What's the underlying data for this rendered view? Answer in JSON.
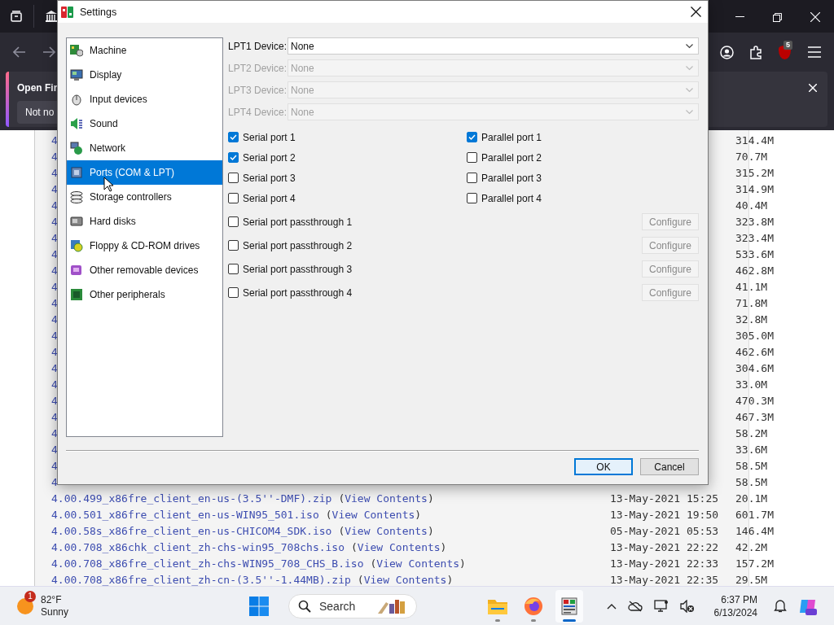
{
  "browser": {
    "notification": {
      "title": "Open Fir",
      "button": "Not no"
    },
    "extension_badge": "5"
  },
  "listing": {
    "rows": [
      {
        "name": "4",
        "size": "314.4M"
      },
      {
        "name": "4",
        "size": "70.7M"
      },
      {
        "name": "4",
        "size": "315.2M"
      },
      {
        "name": "4",
        "size": "314.9M"
      },
      {
        "name": "4",
        "size": "40.4M"
      },
      {
        "name": "4",
        "size": "323.8M"
      },
      {
        "name": "4",
        "size": "323.4M"
      },
      {
        "name": "4",
        "size": "533.6M"
      },
      {
        "name": "4",
        "size": "462.8M"
      },
      {
        "name": "4",
        "size": "41.1M"
      },
      {
        "name": "4",
        "size": "71.8M"
      },
      {
        "name": "4",
        "size": "32.8M"
      },
      {
        "name": "4",
        "size": "305.0M"
      },
      {
        "name": "4",
        "size": "462.6M"
      },
      {
        "name": "4",
        "size": "304.6M"
      },
      {
        "name": "4",
        "size": "33.0M"
      },
      {
        "name": "4",
        "size": "470.3M"
      },
      {
        "name": "4",
        "size": "467.3M"
      },
      {
        "name": "4",
        "size": "58.2M"
      },
      {
        "name": "4",
        "size": "33.6M"
      },
      {
        "name": "4",
        "size": "58.5M"
      },
      {
        "name": "4",
        "size": "58.5M"
      },
      {
        "name": "4.00.499_x86fre_client_en-us-(3.5''-DMF).zip",
        "link": "(View Contents)",
        "date": "13-May-2021 15:25",
        "size": "20.1M"
      },
      {
        "name": "4.00.501_x86fre_client_en-us-WIN95_501.iso",
        "link": "(View Contents)",
        "date": "13-May-2021 19:50",
        "size": "601.7M"
      },
      {
        "name": "4.00.58s_x86fre_client_en-us-CHICOM4_SDK.iso",
        "link": "(View Contents)",
        "date": "05-May-2021 05:53",
        "size": "146.4M"
      },
      {
        "name": "4.00.708_x86chk_client_zh-chs-win95_708chs.iso",
        "link": "(View Contents)",
        "date": "13-May-2021 22:22",
        "size": "42.2M"
      },
      {
        "name": "4.00.708_x86fre_client_zh-chs-WIN95_708_CHS_B.iso",
        "link": "(View Contents)",
        "date": "13-May-2021 22:33",
        "size": "157.2M"
      },
      {
        "name": "4.00.708_x86fre_client_zh-cn-(3.5''-1.44MB).zip",
        "link": "(View Contents)",
        "date": "13-May-2021 22:35",
        "size": "29.5M"
      }
    ]
  },
  "dialog": {
    "title": "Settings",
    "sidebar": {
      "items": [
        {
          "label": "Machine",
          "selected": false
        },
        {
          "label": "Display",
          "selected": false
        },
        {
          "label": "Input devices",
          "selected": false
        },
        {
          "label": "Sound",
          "selected": false
        },
        {
          "label": "Network",
          "selected": false
        },
        {
          "label": "Ports (COM & LPT)",
          "selected": true
        },
        {
          "label": "Storage controllers",
          "selected": false
        },
        {
          "label": "Hard disks",
          "selected": false
        },
        {
          "label": "Floppy & CD-ROM drives",
          "selected": false
        },
        {
          "label": "Other removable devices",
          "selected": false
        },
        {
          "label": "Other peripherals",
          "selected": false
        }
      ]
    },
    "lpt_devices": [
      {
        "label": "LPT1 Device:",
        "value": "None",
        "disabled": false
      },
      {
        "label": "LPT2 Device:",
        "value": "None",
        "disabled": true
      },
      {
        "label": "LPT3 Device:",
        "value": "None",
        "disabled": true
      },
      {
        "label": "LPT4 Device:",
        "value": "None",
        "disabled": true
      }
    ],
    "serial_ports": [
      {
        "label": "Serial port 1",
        "checked": true
      },
      {
        "label": "Serial port 2",
        "checked": true
      },
      {
        "label": "Serial port 3",
        "checked": false
      },
      {
        "label": "Serial port 4",
        "checked": false
      }
    ],
    "parallel_ports": [
      {
        "label": "Parallel port 1",
        "checked": true
      },
      {
        "label": "Parallel port 2",
        "checked": false
      },
      {
        "label": "Parallel port 3",
        "checked": false
      },
      {
        "label": "Parallel port 4",
        "checked": false
      }
    ],
    "passthrough": [
      {
        "label": "Serial port passthrough 1",
        "checked": false,
        "button": "Configure",
        "button_disabled": true
      },
      {
        "label": "Serial port passthrough 2",
        "checked": false,
        "button": "Configure",
        "button_disabled": true
      },
      {
        "label": "Serial port passthrough 3",
        "checked": false,
        "button": "Configure",
        "button_disabled": true
      },
      {
        "label": "Serial port passthrough 4",
        "checked": false,
        "button": "Configure",
        "button_disabled": true
      }
    ],
    "buttons": [
      {
        "label": "OK",
        "default": true
      },
      {
        "label": "Cancel",
        "default": false
      }
    ]
  },
  "taskbar": {
    "weather": {
      "badge": "1",
      "temperature": "82°F",
      "condition": "Sunny"
    },
    "search": {
      "placeholder": "Search"
    },
    "apps": [
      {
        "kind": "files",
        "active": false
      },
      {
        "kind": "firefox",
        "active": false
      },
      {
        "kind": "emulator",
        "active": true
      }
    ],
    "clock": {
      "time": "6:37 PM",
      "date": "6/13/2024"
    }
  }
}
